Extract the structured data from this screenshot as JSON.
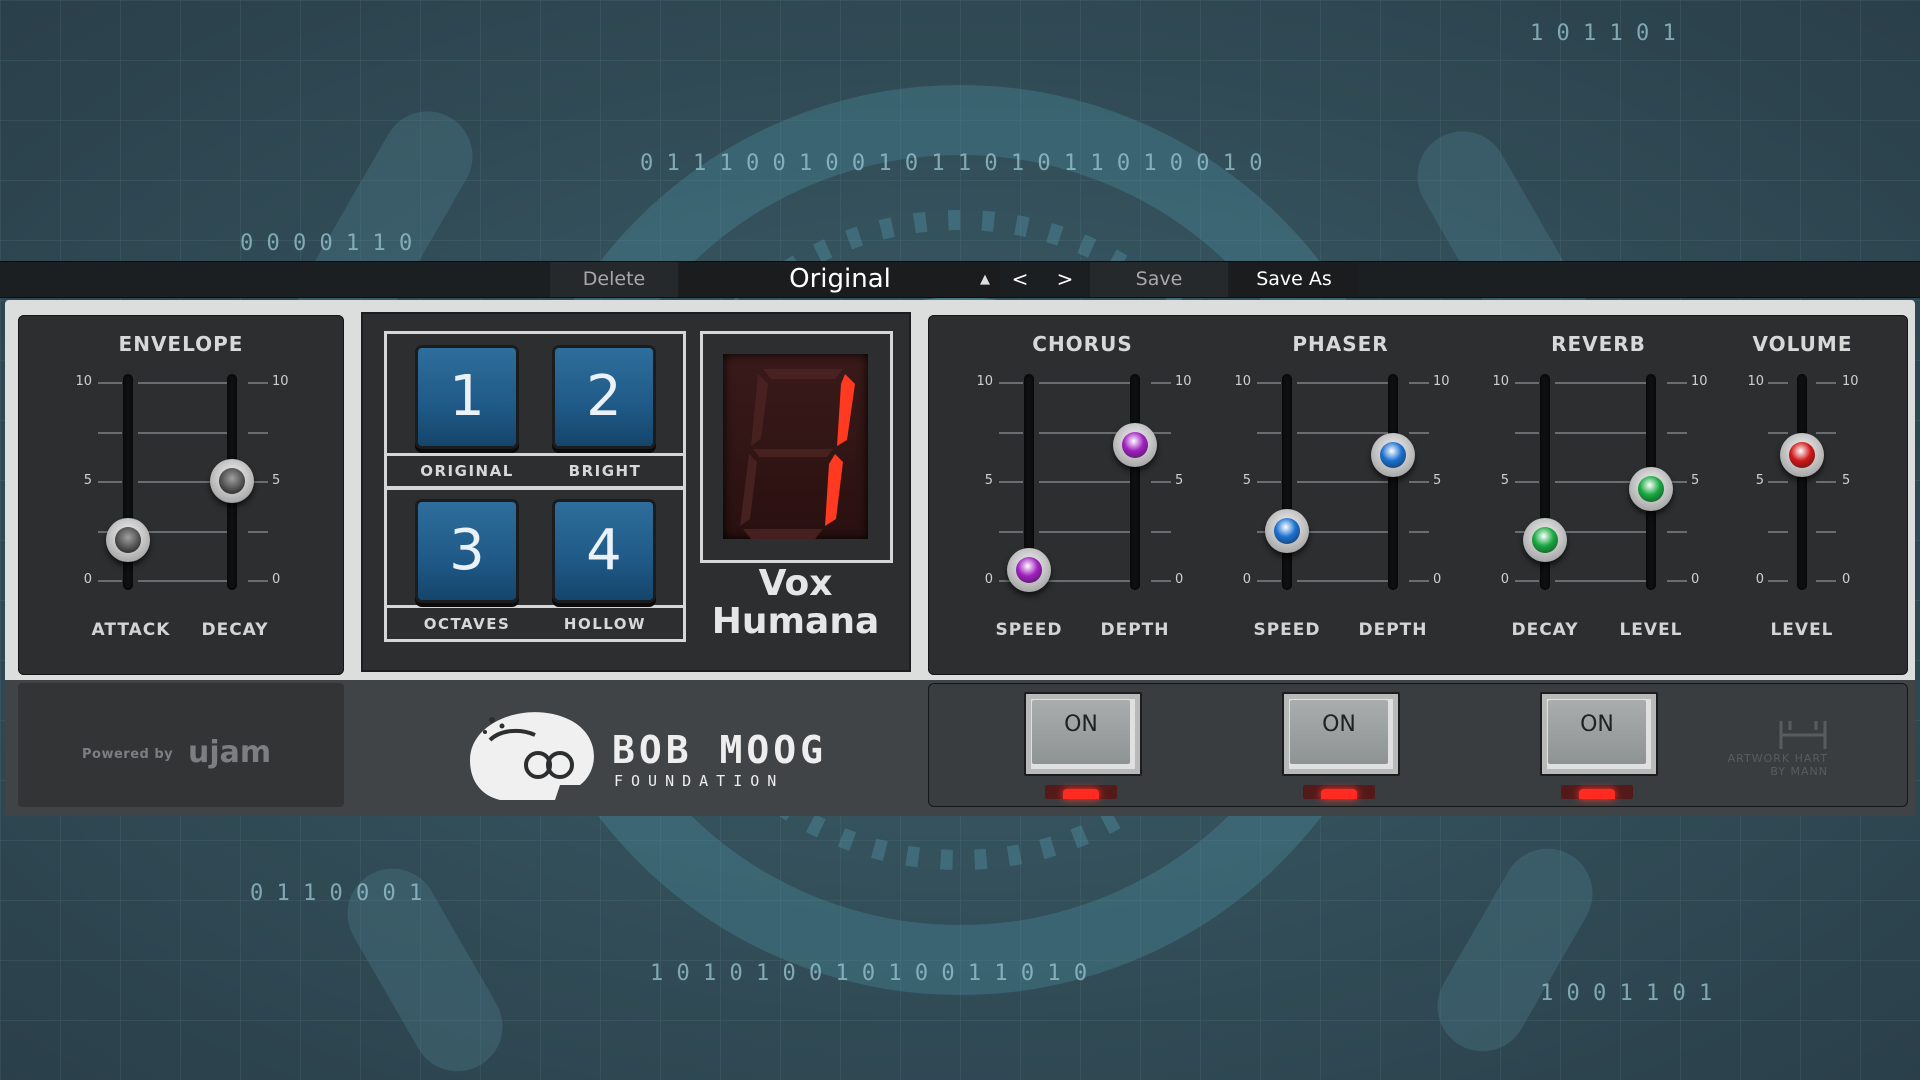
{
  "toolbar": {
    "delete_label": "Delete",
    "preset_name": "Original",
    "preset_arrows": "▲▼",
    "prev_label": "<",
    "next_label": ">",
    "save_label": "Save",
    "save_as_label": "Save As"
  },
  "envelope": {
    "title": "ENVELOPE",
    "tick_labels": [
      "10",
      "5",
      "0"
    ],
    "attack": {
      "label": "ATTACK",
      "value": 2
    },
    "decay": {
      "label": "DECAY",
      "value": 5
    }
  },
  "presets": {
    "buttons": [
      {
        "number": "1",
        "label": "ORIGINAL"
      },
      {
        "number": "2",
        "label": "BRIGHT"
      },
      {
        "number": "3",
        "label": "OCTAVES"
      },
      {
        "number": "4",
        "label": "HOLLOW"
      }
    ],
    "display_digit": "1",
    "voice_name_line1": "Vox",
    "voice_name_line2": "Humana"
  },
  "effects": {
    "chorus": {
      "title": "CHORUS",
      "speed": {
        "label": "SPEED",
        "value": 0.5
      },
      "depth": {
        "label": "DEPTH",
        "value": 6.8
      },
      "knob_color": "#a020c0",
      "toggle": "ON"
    },
    "phaser": {
      "title": "PHASER",
      "speed": {
        "label": "SPEED",
        "value": 2.5
      },
      "depth": {
        "label": "DEPTH",
        "value": 6.3
      },
      "knob_color": "#1a70d0",
      "toggle": "ON"
    },
    "reverb": {
      "title": "REVERB",
      "decay": {
        "label": "DECAY",
        "value": 2.0
      },
      "level": {
        "label": "LEVEL",
        "value": 4.6
      },
      "knob_color": "#18a840",
      "toggle": "ON"
    },
    "volume": {
      "title": "VOLUME",
      "level": {
        "label": "LEVEL",
        "value": 6.3
      },
      "knob_color": "#d01818"
    },
    "tick_labels": [
      "10",
      "5",
      "0"
    ]
  },
  "footer": {
    "powered_by": "Powered by",
    "powered_brand": "ujam",
    "foundation_name": "BOB MOOG",
    "foundation_sub": "FOUNDATION",
    "artwork_line1": "ARTWORK HART",
    "artwork_line2": "BY MANN"
  }
}
